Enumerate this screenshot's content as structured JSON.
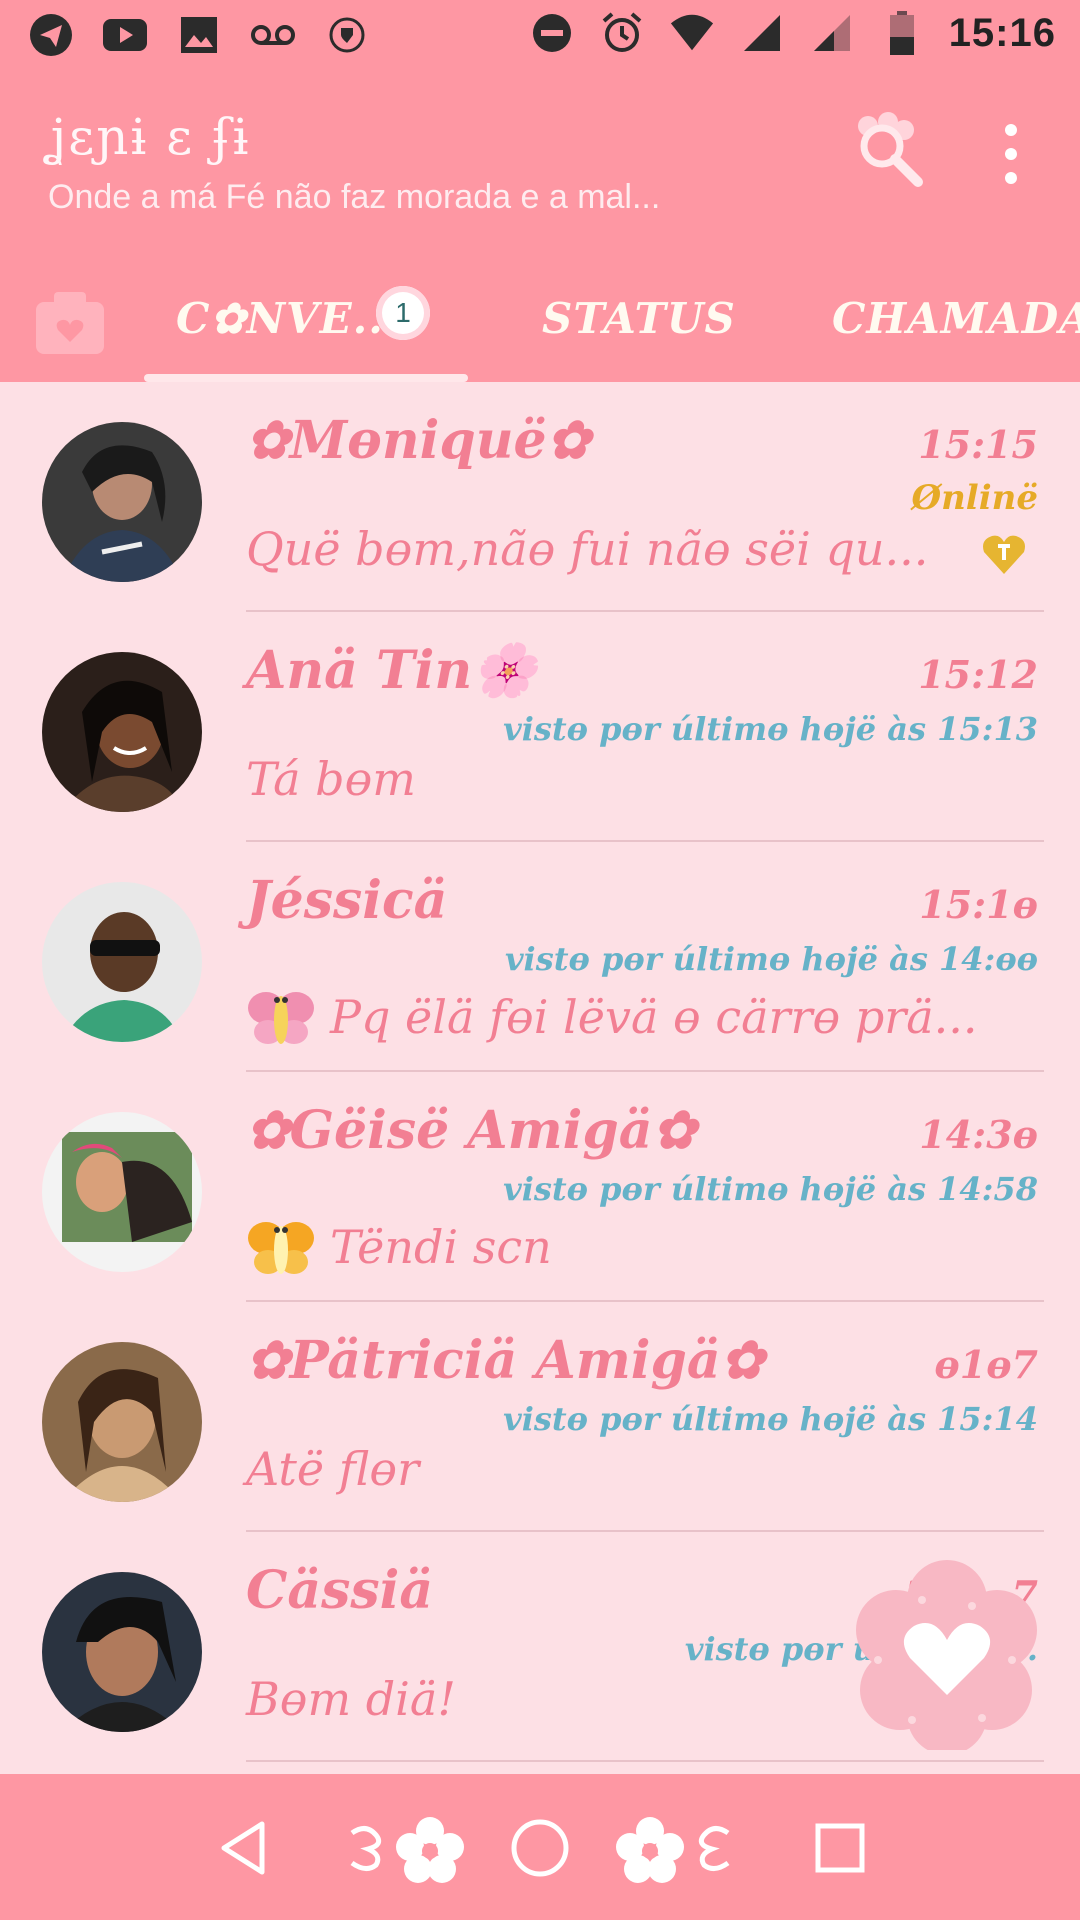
{
  "status_bar": {
    "time": "15:16",
    "left_icons": [
      "telegram-icon",
      "youtube-icon",
      "gallery-icon",
      "voicemail-icon",
      "shield-icon"
    ],
    "right_icons": [
      "do-not-disturb-icon",
      "alarm-icon",
      "wifi-icon",
      "signal-icon",
      "signal-icon",
      "battery-icon"
    ]
  },
  "app_bar": {
    "title": "ʝɛɲɨ ɛ ʄɨ",
    "subtitle": "Onde a má Fé não faz morada e a mal...",
    "search_icon": "search-icon",
    "more_icon": "more-vert-icon"
  },
  "tabs": {
    "camera_icon": "camera-icon",
    "chats": "C✿NVE...",
    "chats_badge": "1",
    "status": "STATUS",
    "calls": "CHAMADAS"
  },
  "chats": [
    {
      "name": "✿Mɵniquë✿",
      "time": "15:15",
      "status": "Ønlinë",
      "preview": "Quë bɵm,nãɵ fui nãɵ sëi qu...",
      "pinned": true
    },
    {
      "name": "Anä Tin🌸",
      "time": "15:12",
      "status": "vistɵ pɵr últimɵ hɵjë às 15:13",
      "preview": "Tá bɵm"
    },
    {
      "name": "Jéssicä",
      "time": "15:1ɵ",
      "status": "vistɵ pɵr últimɵ hɵjë às 14:ɵɵ",
      "preview": "Pq ëlä fɵi lëvä ɵ cärrɵ prä...",
      "preview_icon": "butterfly-icon"
    },
    {
      "name": "✿Gëisë Amigä✿",
      "time": "14:3ɵ",
      "status": "vistɵ pɵr últimɵ hɵjë às 14:58",
      "preview": "Tëndi scn",
      "preview_icon": "butterfly-icon"
    },
    {
      "name": "✿Pätriciä Amigä✿",
      "time": "ɵ1ɵ7",
      "status": "vistɵ pɵr últimɵ hɵjë às 15:14",
      "preview": "Atë flɵr"
    },
    {
      "name": "Cässiä",
      "time": "26/...7",
      "status": "vistɵ pɵr últimɵ h...",
      "preview": "Bɵm diä!"
    }
  ],
  "fab": {
    "icon": "heart-flower-icon"
  },
  "nav": {
    "back_icon": "back-icon",
    "home_icon": "home-icon",
    "recents_icon": "recents-icon"
  },
  "colors": {
    "primary": "#fe97a3",
    "background": "#fde0e5",
    "name_pink": "#f27f93",
    "seen_blue": "#66b2c8",
    "online_gold": "#e6aa27"
  }
}
